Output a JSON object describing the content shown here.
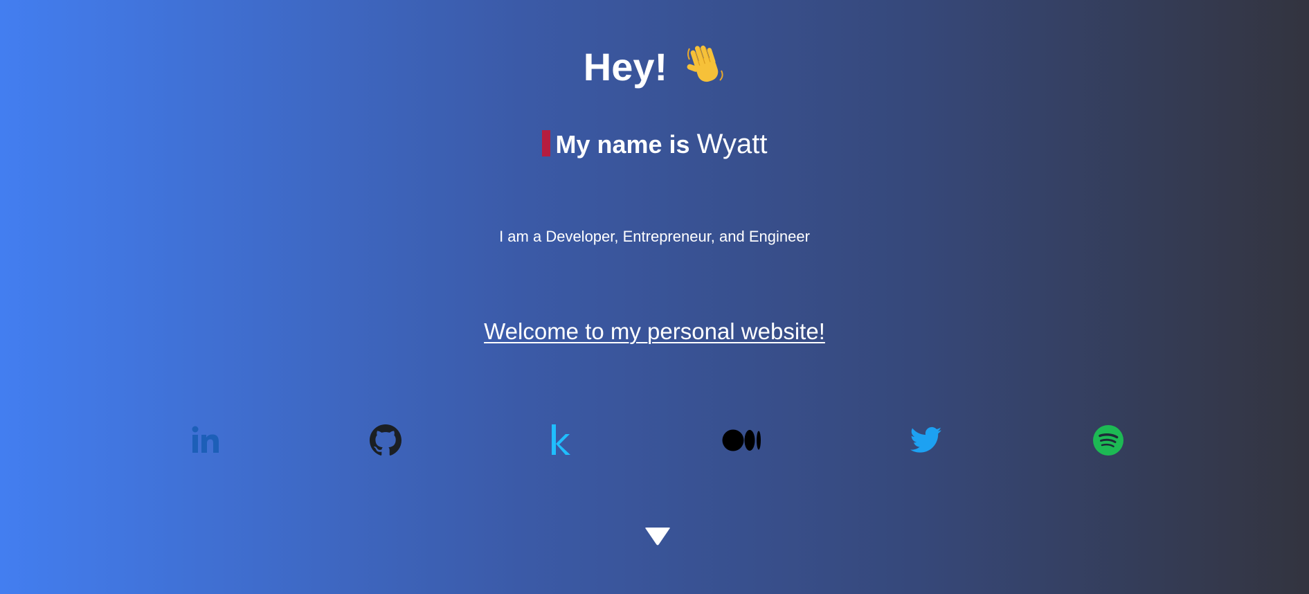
{
  "hero": {
    "greeting": "Hey!",
    "greeting_emoji": "wave-hand-icon",
    "name_prefix": "My name is",
    "name": "Wyatt",
    "tagline": "I am a Developer, Entrepreneur, and Engineer",
    "welcome_link": "Welcome to my personal website!"
  },
  "social_links": [
    {
      "name": "LinkedIn",
      "icon": "linkedin-icon",
      "color": "#1d5fb8"
    },
    {
      "name": "GitHub",
      "icon": "github-icon",
      "color": "#1b1f23"
    },
    {
      "name": "Kaggle",
      "icon": "kaggle-icon",
      "color": "#20beff"
    },
    {
      "name": "Medium",
      "icon": "medium-icon",
      "color": "#000000"
    },
    {
      "name": "Twitter",
      "icon": "twitter-icon",
      "color": "#1da1f2"
    },
    {
      "name": "Spotify",
      "icon": "spotify-icon",
      "color": "#1db954"
    }
  ],
  "scroll_indicator": {
    "icon": "chevron-down-icon"
  },
  "colors": {
    "gradient_start": "#437ef0",
    "gradient_end": "#33343f",
    "cursor": "#b61d3f",
    "text": "#ffffff"
  }
}
